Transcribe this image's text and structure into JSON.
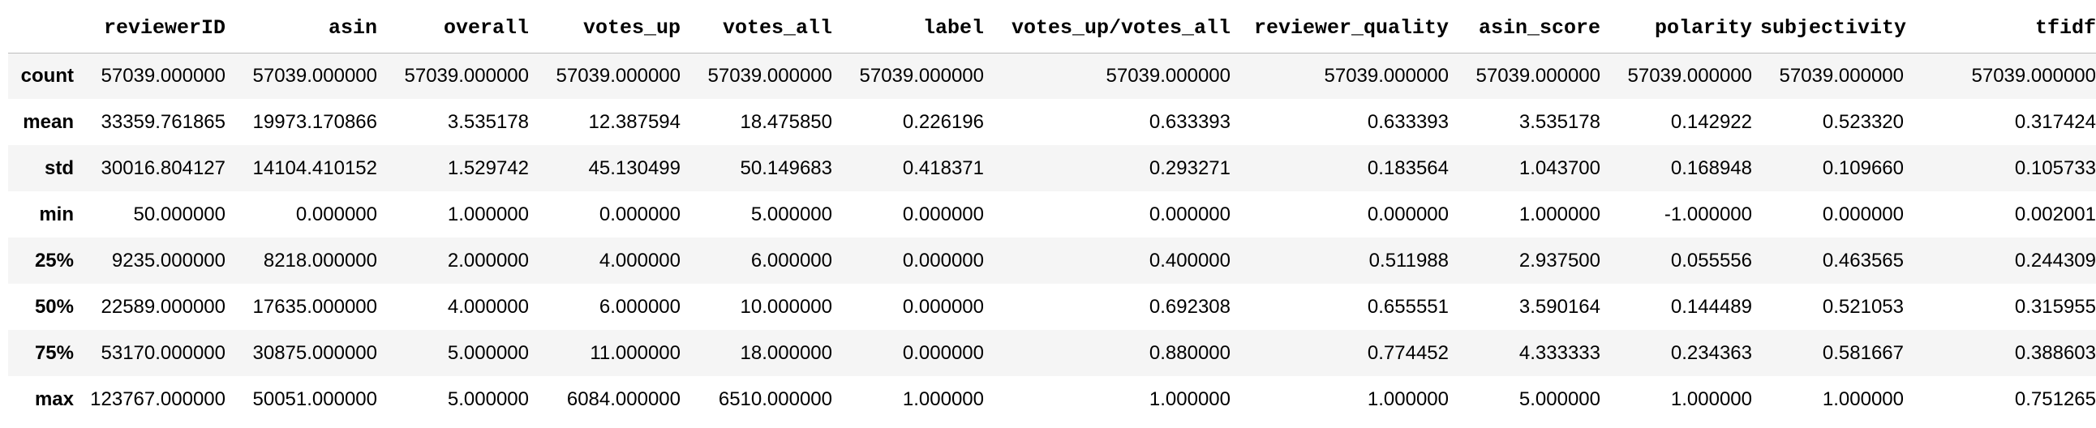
{
  "table": {
    "index_header": "",
    "columns": [
      "reviewerID",
      "asin",
      "overall",
      "votes_up",
      "votes_all",
      "label",
      "votes_up/votes_all",
      "reviewer_quality",
      "asin_score",
      "polarity",
      "subjectivity",
      "tfidf"
    ],
    "rows": [
      {
        "index": "count",
        "values": [
          "57039.000000",
          "57039.000000",
          "57039.000000",
          "57039.000000",
          "57039.000000",
          "57039.000000",
          "57039.000000",
          "57039.000000",
          "57039.000000",
          "57039.000000",
          "57039.000000",
          "57039.000000"
        ]
      },
      {
        "index": "mean",
        "values": [
          "33359.761865",
          "19973.170866",
          "3.535178",
          "12.387594",
          "18.475850",
          "0.226196",
          "0.633393",
          "0.633393",
          "3.535178",
          "0.142922",
          "0.523320",
          "0.317424"
        ]
      },
      {
        "index": "std",
        "values": [
          "30016.804127",
          "14104.410152",
          "1.529742",
          "45.130499",
          "50.149683",
          "0.418371",
          "0.293271",
          "0.183564",
          "1.043700",
          "0.168948",
          "0.109660",
          "0.105733"
        ]
      },
      {
        "index": "min",
        "values": [
          "50.000000",
          "0.000000",
          "1.000000",
          "0.000000",
          "5.000000",
          "0.000000",
          "0.000000",
          "0.000000",
          "1.000000",
          "-1.000000",
          "0.000000",
          "0.002001"
        ]
      },
      {
        "index": "25%",
        "values": [
          "9235.000000",
          "8218.000000",
          "2.000000",
          "4.000000",
          "6.000000",
          "0.000000",
          "0.400000",
          "0.511988",
          "2.937500",
          "0.055556",
          "0.463565",
          "0.244309"
        ]
      },
      {
        "index": "50%",
        "values": [
          "22589.000000",
          "17635.000000",
          "4.000000",
          "6.000000",
          "10.000000",
          "0.000000",
          "0.692308",
          "0.655551",
          "3.590164",
          "0.144489",
          "0.521053",
          "0.315955"
        ]
      },
      {
        "index": "75%",
        "values": [
          "53170.000000",
          "30875.000000",
          "5.000000",
          "11.000000",
          "18.000000",
          "0.000000",
          "0.880000",
          "0.774452",
          "4.333333",
          "0.234363",
          "0.581667",
          "0.388603"
        ]
      },
      {
        "index": "max",
        "values": [
          "123767.000000",
          "50051.000000",
          "5.000000",
          "6084.000000",
          "6510.000000",
          "1.000000",
          "1.000000",
          "1.000000",
          "5.000000",
          "1.000000",
          "1.000000",
          "0.751265"
        ]
      }
    ]
  }
}
